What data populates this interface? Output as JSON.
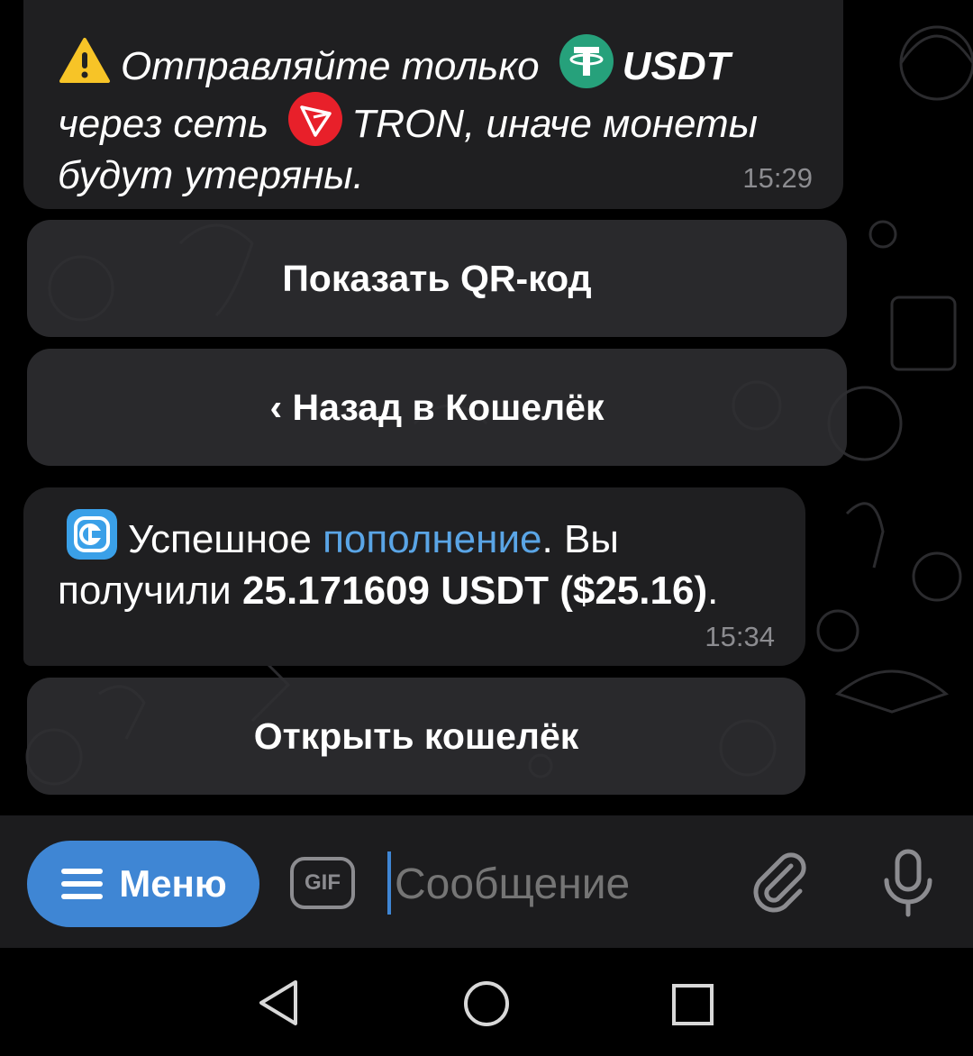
{
  "messages": [
    {
      "line1_text": "Отправляйте только",
      "line1_token": "USDT",
      "line2_text": "через сеть",
      "line2_token": "TRON",
      "line2_rest": ", иначе монеты",
      "line3_text": "будут утеряны.",
      "time": "15:29"
    },
    {
      "prefix": "Успешное",
      "link": "пополнение",
      "suffix": ". Вы",
      "line2_text": "получили",
      "line2_bold": "25.171609 USDT ($25.16)",
      "line2_end": ".",
      "time": "15:34"
    }
  ],
  "keyboard_buttons": {
    "show_qr": "Показать QR-код",
    "back": "‹ Назад в Кошелёк",
    "open_wallet": "Открыть кошелёк"
  },
  "input": {
    "menu_label": "Меню",
    "gif_label": "GIF",
    "placeholder": "Сообщение"
  },
  "colors": {
    "accent": "#3f86d4",
    "link": "#5aa5e6",
    "bubble": "#1f1f21",
    "tether": "#26a17b",
    "tron": "#e8202a",
    "warning": "#f7c427"
  },
  "icons": [
    "warning-icon",
    "tether-icon",
    "tron-icon",
    "wallet-icon",
    "menu-icon",
    "gif-icon",
    "attach-icon",
    "mic-icon",
    "back-nav-icon",
    "home-nav-icon",
    "recents-nav-icon"
  ]
}
